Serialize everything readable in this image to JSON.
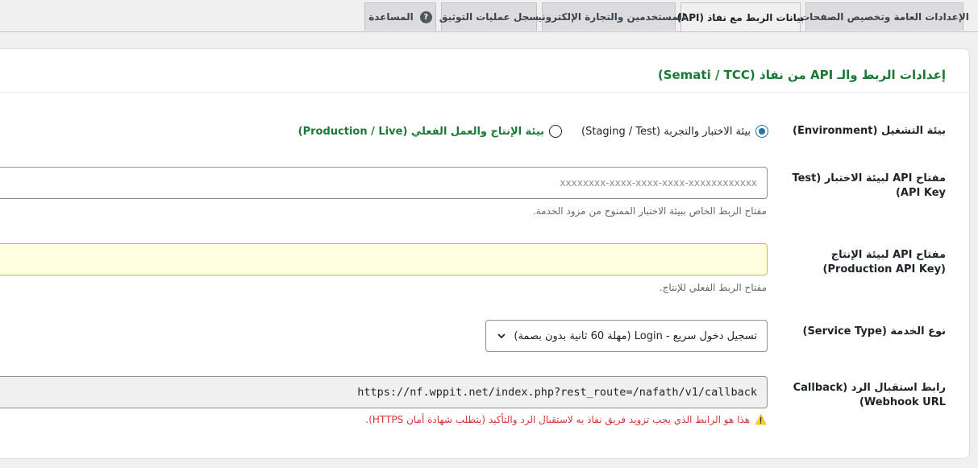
{
  "tabs": [
    {
      "label": "الإعدادات العامة وتخصيص الصفحات",
      "active": false
    },
    {
      "label": "بيانات الربط مع نفاذ (API)",
      "active": true
    },
    {
      "label": "المستخدمين والتجارة الإلكترونية",
      "active": false
    },
    {
      "label": "سجل عمليات التوثيق",
      "active": false
    },
    {
      "label": "المساعدة",
      "active": false,
      "icon": "help-icon"
    }
  ],
  "section": {
    "title": "إعدادات الربط والـ API من نفاذ (Semati / TCC)"
  },
  "environment": {
    "label": "بيئة التشغيل (Environment)",
    "options": [
      {
        "label": "بيئة الاختبار والتجربة (Staging / Test)",
        "checked": true
      },
      {
        "label": "بيئة الإنتاج والعمل الفعلي (Production / Live)",
        "checked": false
      }
    ]
  },
  "test_key": {
    "label": "مفتاح API لبيئة الاختبار (Test API Key)",
    "placeholder": "xxxxxxxx-xxxx-xxxx-xxxx-xxxxxxxxxxxx",
    "description": "مفتاح الربط الخاص ببيئة الاختبار الممنوح من مزود الخدمة."
  },
  "prod_key": {
    "label": "مفتاح API لبيئة الإنتاج (Production API Key)",
    "value": "",
    "description": "مفتاح الربط الفعلي للإنتاج."
  },
  "service_type": {
    "label": "نوع الخدمة (Service Type)",
    "selected": "تسجيل دخول سريع - Login (مهلة 60 ثانية بدون بصمة)"
  },
  "callback": {
    "label": "رابط استقبال الرد (Callback Webhook URL)",
    "value": "https://nf.wppit.net/index.php?rest_route=/nafath/v1/callback",
    "warning": "هذا هو الرابط الذي يجب تزويد فريق نفاذ به لاستقبال الرد والتأكيد (يتطلب شهادة أمان HTTPS).",
    "warning_icon": "warning-icon"
  },
  "colors": {
    "accent": "#2271b1",
    "title_green": "#1a7a35",
    "warning_red": "#d63638"
  }
}
